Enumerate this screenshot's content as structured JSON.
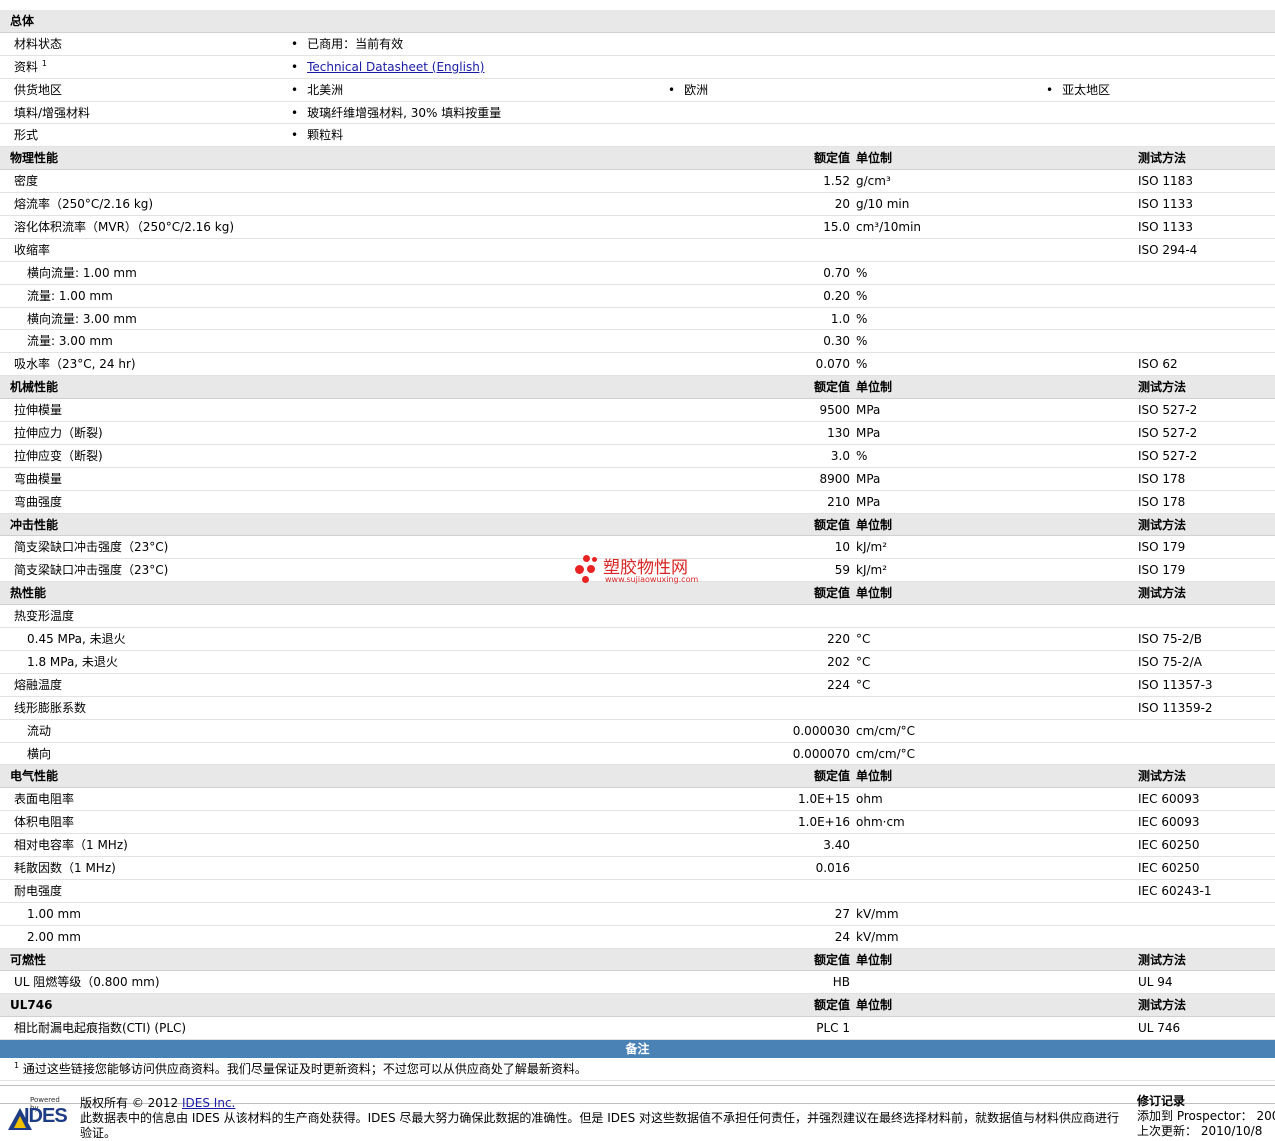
{
  "headers": {
    "value": "额定值",
    "unit": "单位制",
    "test": "测试方法"
  },
  "general": {
    "title": "总体",
    "status_label": "材料状态",
    "status_value": "已商用：当前有效",
    "doc_label": "资料",
    "doc_sup": "1",
    "doc_link": "Technical Datasheet (English)",
    "region_label": "供货地区",
    "regions": [
      "北美洲",
      "欧洲",
      "亚太地区"
    ],
    "filler_label": "填料/增强材料",
    "filler_value": "玻璃纤维增强材料, 30% 填料按重量",
    "form_label": "形式",
    "form_value": "颗粒料"
  },
  "physical": {
    "title": "物理性能",
    "rows": [
      {
        "label": "密度",
        "value": "1.52",
        "unit": "g/cm³",
        "test": "ISO 1183"
      },
      {
        "label": "熔流率（250°C/2.16 kg)",
        "value": "20",
        "unit": "g/10 min",
        "test": "ISO 1133"
      },
      {
        "label": "溶化体积流率（MVR）（250°C/2.16 kg)",
        "value": "15.0",
        "unit": "cm³/10min",
        "test": "ISO 1133"
      },
      {
        "label": "收缩率",
        "value": "",
        "unit": "",
        "test": "ISO 294-4"
      },
      {
        "label": "横向流量: 1.00 mm",
        "value": "0.70",
        "unit": "%",
        "test": ""
      },
      {
        "label": "流量: 1.00 mm",
        "value": "0.20",
        "unit": "%",
        "test": ""
      },
      {
        "label": "横向流量: 3.00 mm",
        "value": "1.0",
        "unit": "%",
        "test": ""
      },
      {
        "label": "流量: 3.00 mm",
        "value": "0.30",
        "unit": "%",
        "test": ""
      },
      {
        "label": "吸水率（23°C, 24 hr)",
        "value": "0.070",
        "unit": "%",
        "test": "ISO 62"
      }
    ]
  },
  "mechanical": {
    "title": "机械性能",
    "rows": [
      {
        "label": "拉伸模量",
        "value": "9500",
        "unit": "MPa",
        "test": "ISO 527-2"
      },
      {
        "label": "拉伸应力（断裂)",
        "value": "130",
        "unit": "MPa",
        "test": "ISO 527-2"
      },
      {
        "label": "拉伸应变（断裂)",
        "value": "3.0",
        "unit": "%",
        "test": "ISO 527-2"
      },
      {
        "label": "弯曲模量",
        "value": "8900",
        "unit": "MPa",
        "test": "ISO 178"
      },
      {
        "label": "弯曲强度",
        "value": "210",
        "unit": "MPa",
        "test": "ISO 178"
      }
    ]
  },
  "impact": {
    "title": "冲击性能",
    "rows": [
      {
        "label": "简支梁缺口冲击强度（23°C)",
        "value": "10",
        "unit": "kJ/m²",
        "test": "ISO 179"
      },
      {
        "label": "简支梁缺口冲击强度（23°C)",
        "value": "59",
        "unit": "kJ/m²",
        "test": "ISO 179"
      }
    ]
  },
  "thermal": {
    "title": "热性能",
    "rows": [
      {
        "label": "热变形温度",
        "value": "",
        "unit": "",
        "test": ""
      },
      {
        "label": "0.45 MPa, 未退火",
        "value": "220",
        "unit": "°C",
        "test": "ISO 75-2/B"
      },
      {
        "label": "1.8 MPa, 未退火",
        "value": "202",
        "unit": "°C",
        "test": "ISO 75-2/A"
      },
      {
        "label": "熔融温度",
        "value": "224",
        "unit": "°C",
        "test": "ISO 11357-3"
      },
      {
        "label": "线形膨胀系数",
        "value": "",
        "unit": "",
        "test": "ISO 11359-2"
      },
      {
        "label": "流动",
        "value": "0.000030",
        "unit": "cm/cm/°C",
        "test": ""
      },
      {
        "label": "横向",
        "value": "0.000070",
        "unit": "cm/cm/°C",
        "test": ""
      }
    ]
  },
  "electrical": {
    "title": "电气性能",
    "rows": [
      {
        "label": "表面电阻率",
        "value": "1.0E+15",
        "unit": "ohm",
        "test": "IEC 60093"
      },
      {
        "label": "体积电阻率",
        "value": "1.0E+16",
        "unit": "ohm·cm",
        "test": "IEC 60093"
      },
      {
        "label": "相对电容率（1 MHz)",
        "value": "3.40",
        "unit": "",
        "test": "IEC 60250"
      },
      {
        "label": "耗散因数（1 MHz)",
        "value": "0.016",
        "unit": "",
        "test": "IEC 60250"
      },
      {
        "label": "耐电强度",
        "value": "",
        "unit": "",
        "test": "IEC 60243-1"
      },
      {
        "label": "1.00 mm",
        "value": "27",
        "unit": "kV/mm",
        "test": ""
      },
      {
        "label": "2.00 mm",
        "value": "24",
        "unit": "kV/mm",
        "test": ""
      }
    ]
  },
  "flammability": {
    "title": "可燃性",
    "rows": [
      {
        "label": "UL 阻燃等级（0.800 mm)",
        "value": "HB",
        "unit": "",
        "test": "UL 94"
      }
    ]
  },
  "ul746": {
    "title": "UL746",
    "rows": [
      {
        "label": "相比耐漏电起痕指数(CTI) (PLC)",
        "value": "PLC 1",
        "unit": "",
        "test": "UL 746"
      }
    ]
  },
  "notes": {
    "title": "备注",
    "sup": "1",
    "text": "通过这些链接您能够访问供应商资料。我们尽量保证及时更新资料；不过您可以从供应商处了解最新资料。"
  },
  "footer": {
    "logo_powered": "Powered by",
    "logo_text": "IDES",
    "copyright_prefix": "版权所有 © 2012",
    "copyright_link": "IDES Inc.",
    "disclaimer": "此数据表中的信息由 IDES 从该材料的生产商处获得。IDES 尽最大努力确保此数据的准确性。但是 IDES 对这些数据值不承担任何责任，并强烈建议在最终选择材料前，就数据值与材料供应商进行验证。",
    "rev_title": "修订记录",
    "rev_added": "添加到 Prospector： 200",
    "rev_updated": "上次更新： 2010/10/8"
  },
  "watermark": {
    "cn": "塑胶物性网",
    "url": "www.sujiaowuxing.com"
  },
  "colors": {
    "section_bg": "#e8e8e8",
    "notes_bar": "#4a82b6",
    "link": "#1a1aa6",
    "watermark": "#d92525"
  }
}
